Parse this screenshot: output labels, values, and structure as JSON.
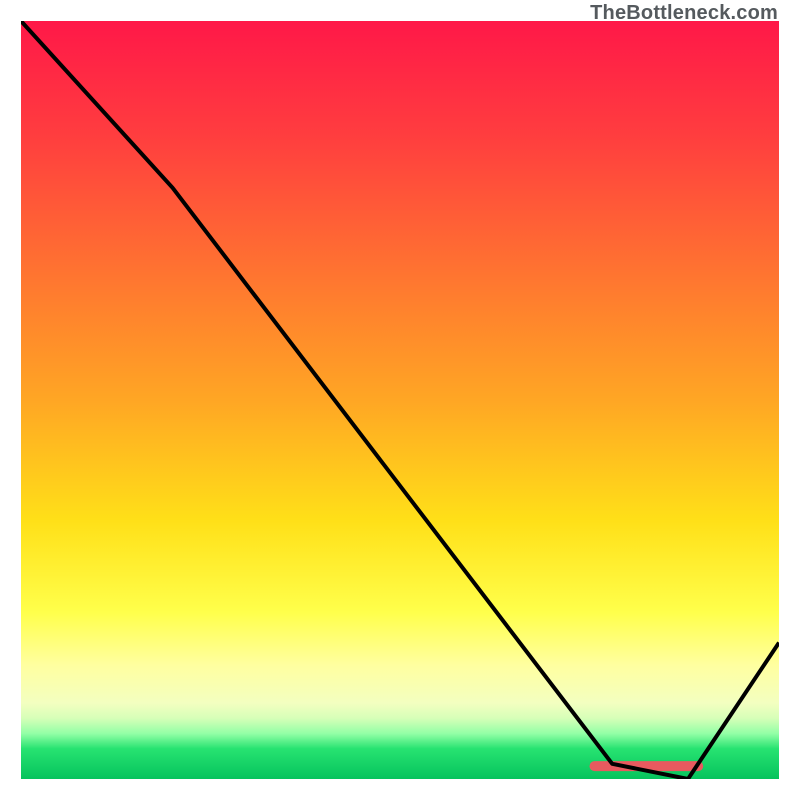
{
  "attribution": "TheBottleneck.com",
  "chart_data": {
    "type": "line",
    "title": "",
    "xlabel": "",
    "ylabel": "",
    "xlim": [
      0,
      100
    ],
    "ylim": [
      0,
      100
    ],
    "series": [
      {
        "name": "curve",
        "x": [
          0,
          20,
          78,
          88,
          100
        ],
        "y": [
          100,
          78,
          2,
          0,
          18
        ]
      }
    ],
    "annotations": [
      {
        "name": "red-bar",
        "x_start": 75,
        "x_end": 90,
        "y": 1.7
      }
    ],
    "background_gradient": [
      {
        "stop": 0.0,
        "color": "#ff1848"
      },
      {
        "stop": 0.15,
        "color": "#ff3d3f"
      },
      {
        "stop": 0.3,
        "color": "#ff6a33"
      },
      {
        "stop": 0.5,
        "color": "#ffa624"
      },
      {
        "stop": 0.66,
        "color": "#ffe018"
      },
      {
        "stop": 0.78,
        "color": "#ffff4b"
      },
      {
        "stop": 0.85,
        "color": "#ffffa0"
      },
      {
        "stop": 0.9,
        "color": "#f3ffc0"
      },
      {
        "stop": 0.92,
        "color": "#d6ffb8"
      },
      {
        "stop": 0.94,
        "color": "#93ffa6"
      },
      {
        "stop": 0.96,
        "color": "#27e371"
      },
      {
        "stop": 1.0,
        "color": "#06c35d"
      }
    ]
  }
}
